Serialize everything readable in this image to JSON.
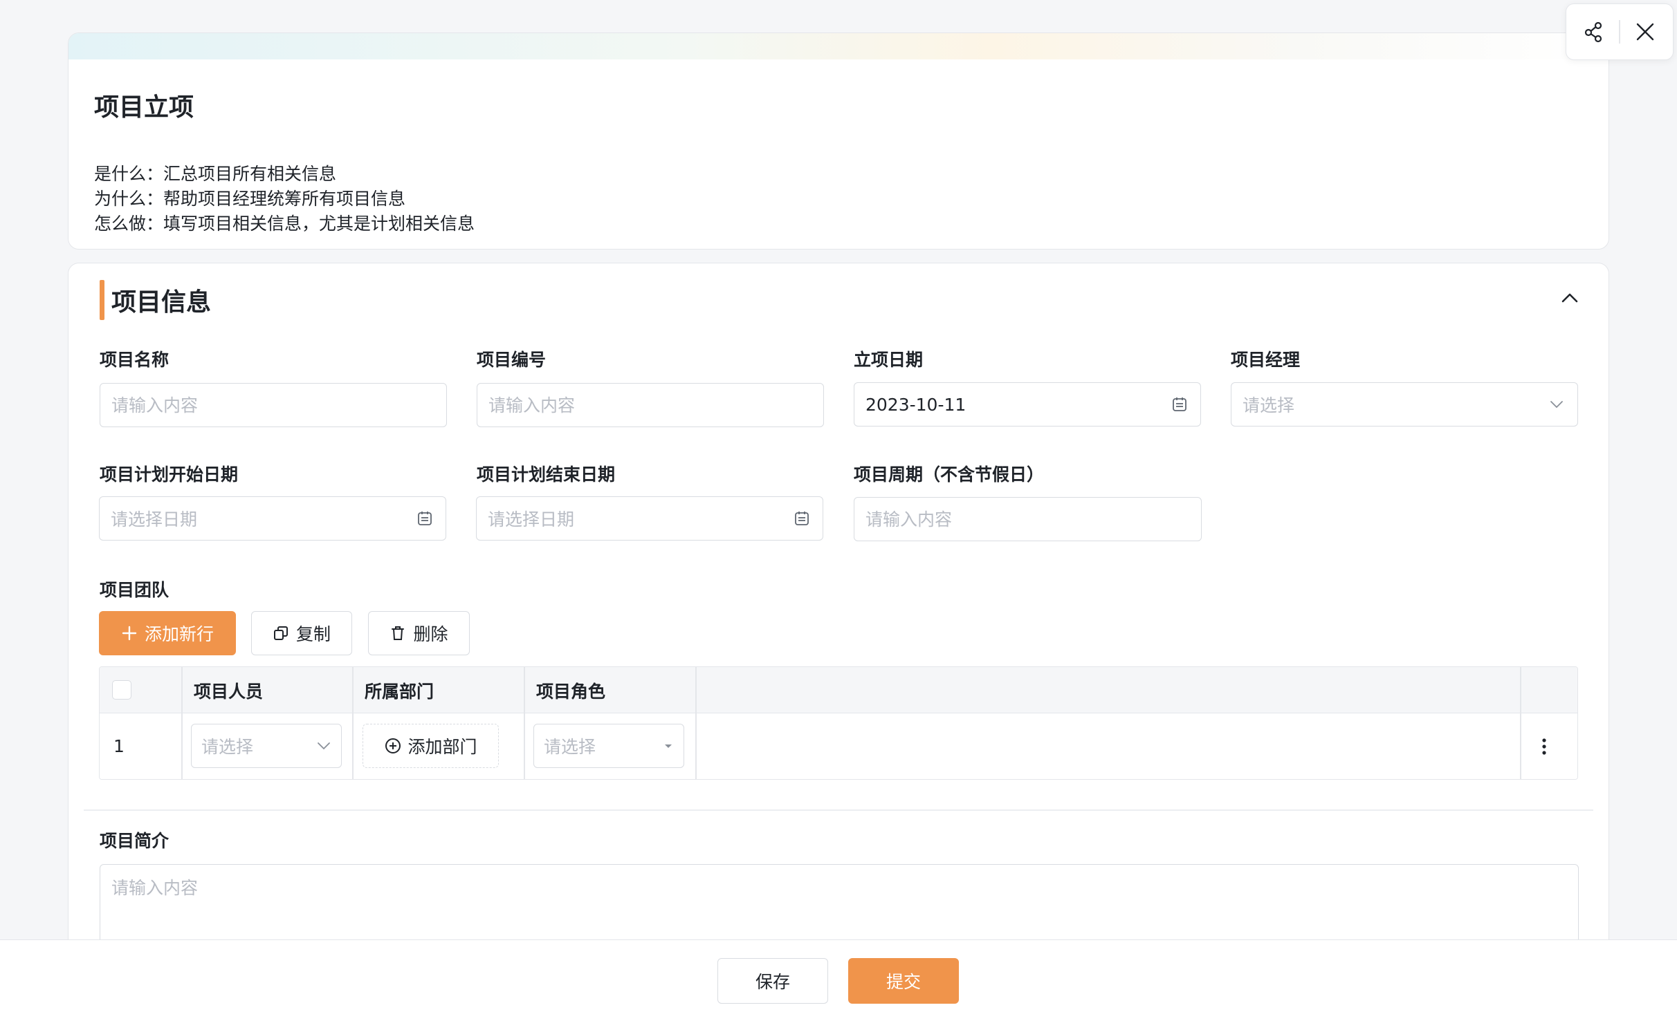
{
  "toolbar": {
    "share_icon": "share-icon",
    "close_icon": "close-icon"
  },
  "header": {
    "title": "项目立项",
    "desc": [
      "是什么：汇总项目所有相关信息",
      "为什么：帮助项目经理统筹所有项目信息",
      "怎么做：填写项目相关信息，尤其是计划相关信息"
    ]
  },
  "section": {
    "title": "项目信息"
  },
  "fields": {
    "name": {
      "label": "项目名称",
      "placeholder": "请输入内容"
    },
    "code": {
      "label": "项目编号",
      "placeholder": "请输入内容"
    },
    "date": {
      "label": "立项日期",
      "value": "2023-10-11"
    },
    "manager": {
      "label": "项目经理",
      "placeholder": "请选择"
    },
    "start": {
      "label": "项目计划开始日期",
      "placeholder": "请选择日期"
    },
    "end": {
      "label": "项目计划结束日期",
      "placeholder": "请选择日期"
    },
    "cycle": {
      "label": "项目周期（不含节假日）",
      "placeholder": "请输入内容"
    }
  },
  "team": {
    "label": "项目团队",
    "add_row": "添加新行",
    "copy": "复制",
    "delete": "删除",
    "columns": [
      "项目人员",
      "所属部门",
      "项目角色"
    ],
    "rows": [
      {
        "index": "1",
        "member_placeholder": "请选择",
        "dept_action": "添加部门",
        "role_placeholder": "请选择"
      }
    ]
  },
  "intro": {
    "label": "项目简介",
    "placeholder": "请输入内容"
  },
  "footer": {
    "save": "保存",
    "submit": "提交"
  },
  "colors": {
    "accent": "#f0944b",
    "border": "#d9dce1",
    "placeholder": "#b8bcc4"
  }
}
